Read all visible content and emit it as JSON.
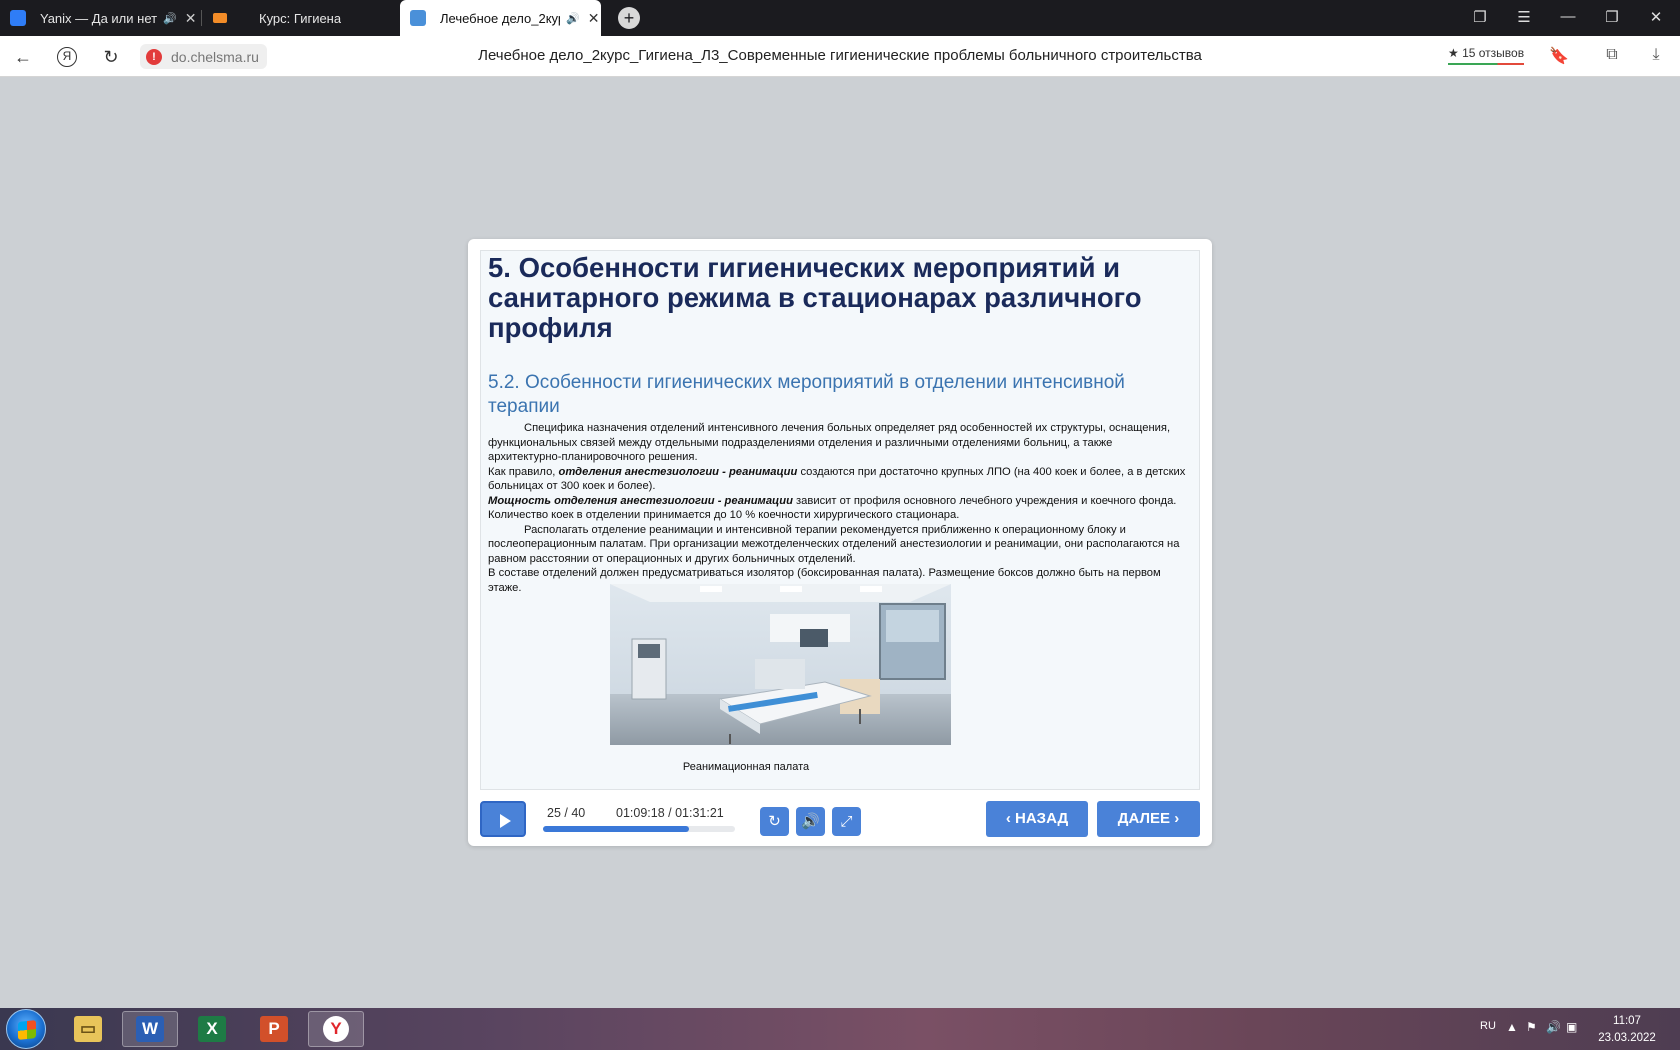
{
  "browser": {
    "tabs": [
      {
        "title": "Yanix — Да или нет",
        "audio": true,
        "favicon_color": "#2f7df6"
      },
      {
        "title": "Курс: Гигиена",
        "audio": false,
        "favicon_color": "#f28c28"
      },
      {
        "title": "Лечебное дело_2курс",
        "audio": true,
        "favicon_color": "#4a90d9",
        "active": true
      }
    ],
    "new_tab_label": "+",
    "url": "do.chelsma.ru",
    "page_title": "Лечебное дело_2курс_Гигиена_Л3_Современные гигиенические проблемы больничного строительства",
    "reviews_label": "15 отзывов"
  },
  "slide": {
    "title": "5. Особенности гигиенических мероприятий и санитарного режима в стационарах различного профиля",
    "subtitle": "5.2. Особенности гигиенических мероприятий в отделении интенсивной терапии",
    "p1": "Специфика назначения отделений интенсивного лечения больных определяет ряд особенностей их структуры, оснащения, функциональных связей между отдельными подразделениями отделения и различными отделениями больниц, а также архитектурно-планировочного решения.",
    "p2_pre": "Как правило, ",
    "p2_bold": "отделения анестезиологии - реанимации",
    "p2_post": " создаются при достаточно крупных ЛПО (на 400 коек и более, а в детских больницах от 300 коек и более).",
    "p3_bold": "Мощность отделения анестезиологии - реанимации",
    "p3_post": " зависит от профиля основного лечебного учреждения и коечного фонда. Количество коек в отделении принимается до 10 % коечности хирургического стационара.",
    "p4": "Располагать отделение реанимации и интенсивной терапии рекомендуется приближенно к операционному блоку и послеоперационным палатам. При организации межотделенческих отделений анестезиологии и реанимации, они располагаются на равном расстоянии от операционных и других больничных отделений.",
    "p5": "В составе отделений должен предусматриваться изолятор (боксированная палата). Размещение боксов должно быть на первом этаже.",
    "photo_caption": "Реанимационная палата"
  },
  "player": {
    "counter": "25 / 40",
    "time": "01:09:18 / 01:31:21",
    "progress": 0.759,
    "back_label": "НАЗАД",
    "next_label": "ДАЛЕЕ",
    "accent_color": "#4a82d8"
  },
  "taskbar": {
    "apps": [
      "windows-explorer",
      "microsoft-word",
      "microsoft-excel",
      "microsoft-powerpoint",
      "yandex-browser"
    ],
    "language": "RU",
    "clock_time": "11:07",
    "clock_date": "23.03.2022"
  }
}
